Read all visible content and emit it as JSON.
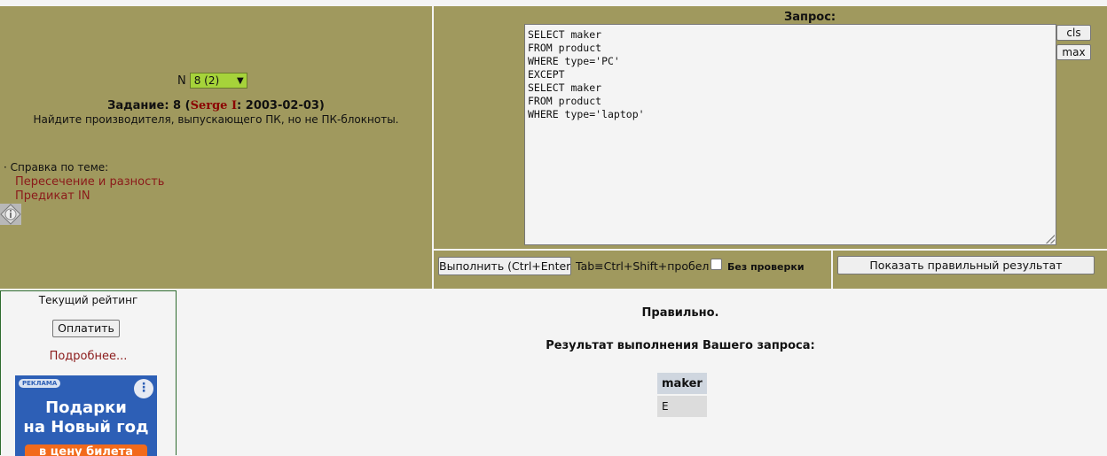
{
  "task": {
    "n_label": "N",
    "select_value": "8 (2)",
    "title_prefix": "Задание: 8 (",
    "author": "Serge I",
    "title_suffix": ": 2003-02-03)",
    "text": "Найдите производителя, выпускающего ПК, но не ПК-блокноты.",
    "help_title": "· Справка по теме:",
    "help_links": [
      "Пересечение и разность",
      "Предикат IN"
    ]
  },
  "query": {
    "label": "Запрос:",
    "text": "SELECT maker\nFROM product\nWHERE type='PC'\nEXCEPT\nSELECT maker\nFROM product\nWHERE type='laptop'",
    "cls_label": "cls",
    "max_label": "max"
  },
  "exec": {
    "button_label": "Выполнить (Ctrl+Enter)",
    "tab_hint": "Tab≡Ctrl+Shift+пробел",
    "nocheck_label": "Без  проверки",
    "nocheck_checked": false
  },
  "show": {
    "button_label": "Показать правильный результат"
  },
  "rating": {
    "title": "Текущий рейтинг",
    "pay_label": "Оплатить",
    "more_label": "Подробнее..."
  },
  "ad": {
    "badge": "РЕКЛАМА",
    "line1": "Подарки",
    "line2": "на Новый год",
    "strip": "в цену билета"
  },
  "result": {
    "status": "Правильно.",
    "title": "Результат выполнения Вашего запроса:",
    "columns": [
      "maker"
    ],
    "rows": [
      [
        "E"
      ]
    ]
  }
}
